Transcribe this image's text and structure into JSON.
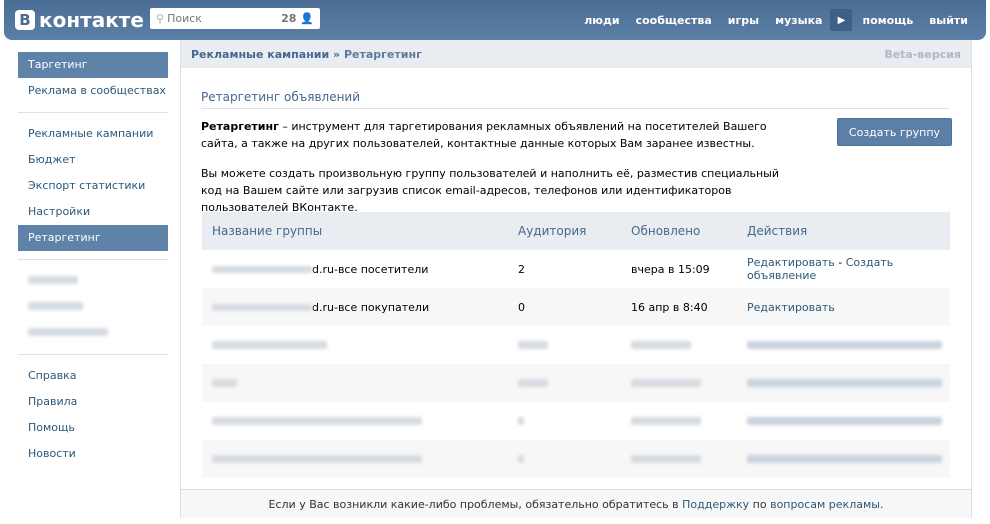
{
  "header": {
    "logo": "контакте",
    "logo_letter": "В",
    "search_placeholder": "Поиск",
    "search_count": "28",
    "nav": [
      "люди",
      "сообщества",
      "игры",
      "музыка",
      "помощь",
      "выйти"
    ]
  },
  "sidebar": {
    "group1": [
      "Таргетинг",
      "Реклама в сообществах"
    ],
    "group2": [
      "Рекламные кампании",
      "Бюджет",
      "Экспорт статистики",
      "Настройки",
      "Ретаргетинг"
    ],
    "group4": [
      "Справка",
      "Правила",
      "Помощь",
      "Новости"
    ]
  },
  "breadcrumb": {
    "parent": "Рекламные кампании",
    "sep": " » ",
    "current": "Ретаргетинг",
    "beta": "Beta-версия"
  },
  "main": {
    "title": "Ретаргетинг объявлений",
    "intro_bold": "Ретаргетинг",
    "intro": " – инструмент для таргетирования рекламных объявлений на посетителей Вашего сайта, а также на других пользователей, контактные данные которых Вам заранее известны.",
    "para2": "Вы можете создать произвольную группу пользователей и наполнить её, разместив специальный код на Вашем сайте или загрузив список email-адресов, телефонов или идентификаторов пользователей ВКонтакте.",
    "create_button": "Создать группу"
  },
  "table": {
    "headers": [
      "Название группы",
      "Аудитория",
      "Обновлено",
      "Действия"
    ],
    "rows": [
      {
        "name": "d.ru-все посетители",
        "audience": "2",
        "updated": "вчера в 15:09",
        "edit": "Редактировать",
        "dash": " - ",
        "create": "Создать объявление"
      },
      {
        "name": "d.ru-все покупатели",
        "audience": "0",
        "updated": "16 апр в 8:40",
        "edit": "Редактировать"
      }
    ]
  },
  "footer": {
    "text": "Если у Вас возникли какие-либо проблемы, обязательно обратитесь в ",
    "support": "Поддержку",
    "mid": " по ",
    "ads": "вопросам рекламы",
    "end": "."
  }
}
